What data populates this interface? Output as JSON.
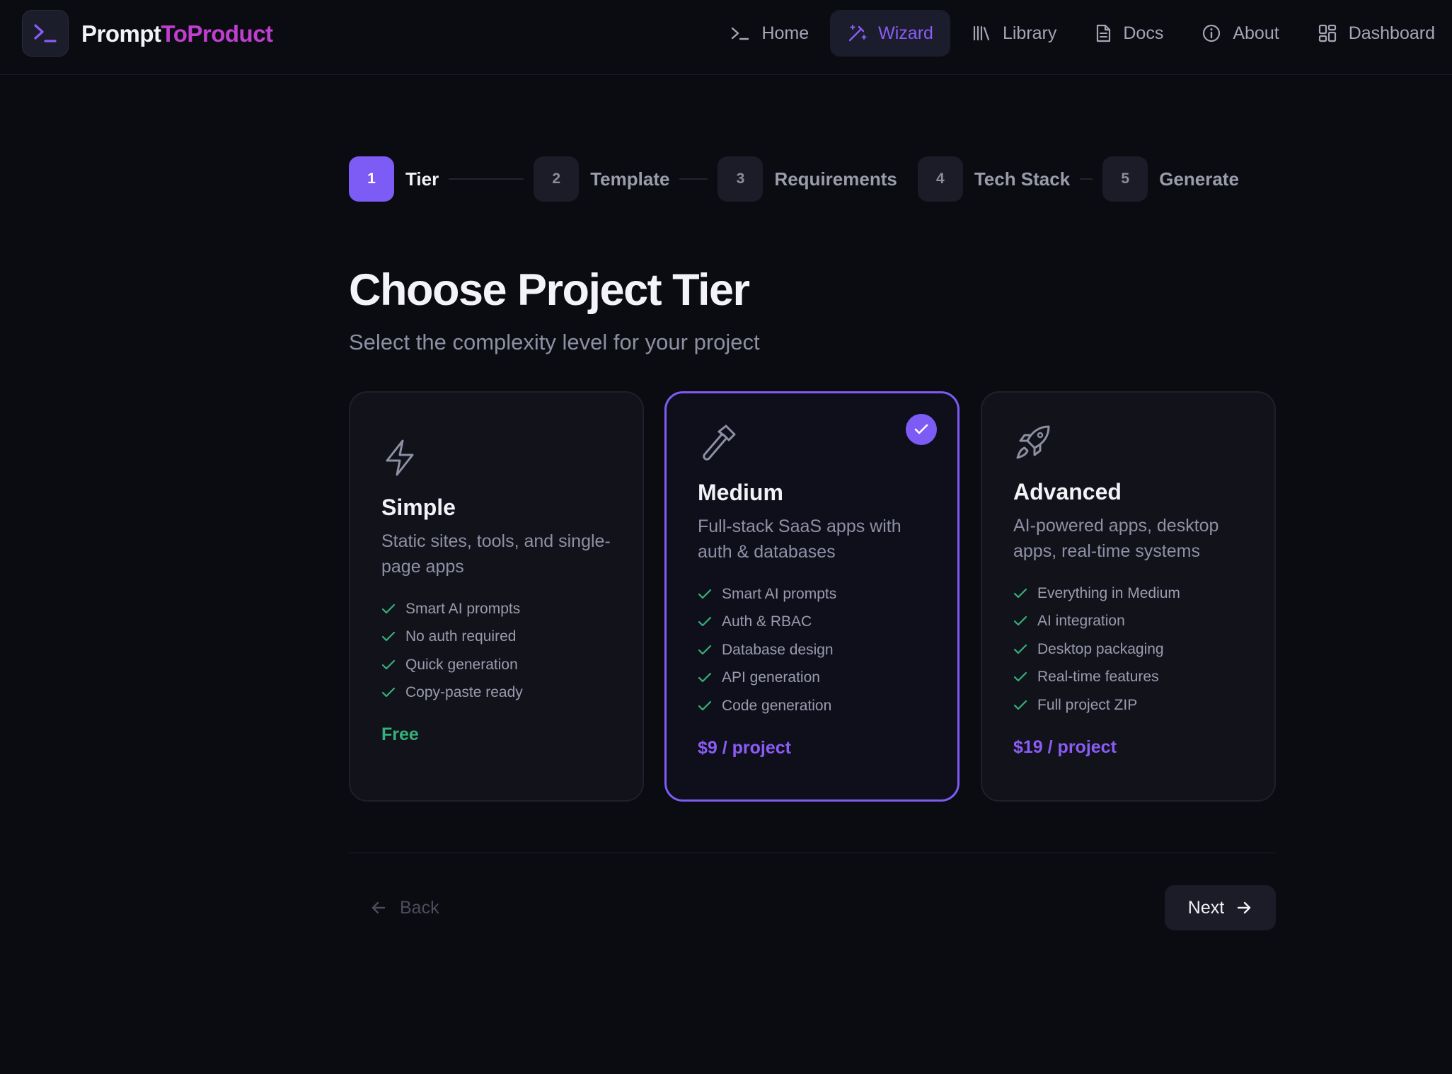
{
  "header": {
    "brand_part1": "Prompt",
    "brand_part2": "ToProduct",
    "logo_icon": "terminal-icon",
    "nav": [
      {
        "label": "Home",
        "icon": "terminal-icon"
      },
      {
        "label": "Wizard",
        "icon": "magic-wand-icon",
        "active": true
      },
      {
        "label": "Library",
        "icon": "library-icon"
      },
      {
        "label": "Docs",
        "icon": "document-icon"
      },
      {
        "label": "About",
        "icon": "info-icon"
      },
      {
        "label": "Dashboard",
        "icon": "grid-icon"
      }
    ]
  },
  "stepper": [
    {
      "num": "1",
      "label": "Tier",
      "active": true
    },
    {
      "num": "2",
      "label": "Template"
    },
    {
      "num": "3",
      "label": "Requirements"
    },
    {
      "num": "4",
      "label": "Tech Stack"
    },
    {
      "num": "5",
      "label": "Generate"
    }
  ],
  "page": {
    "title": "Choose Project Tier",
    "subtitle": "Select the complexity level for your project"
  },
  "tiers": [
    {
      "title": "Simple",
      "icon": "lightning-icon",
      "description": "Static sites, tools, and single-page apps",
      "features": [
        "Smart AI prompts",
        "No auth required",
        "Quick generation",
        "Copy-paste ready"
      ],
      "price": "Free"
    },
    {
      "title": "Medium",
      "icon": "hammer-icon",
      "selected": true,
      "description": "Full-stack SaaS apps with auth & databases",
      "features": [
        "Smart AI prompts",
        "Auth & RBAC",
        "Database design",
        "API generation",
        "Code generation"
      ],
      "price": "$9 / project"
    },
    {
      "title": "Advanced",
      "icon": "rocket-icon",
      "description": "AI-powered apps, desktop apps, real-time systems",
      "features": [
        "Everything in Medium",
        "AI integration",
        "Desktop packaging",
        "Real-time features",
        "Full project ZIP"
      ],
      "price": "$19 / project"
    }
  ],
  "footer": {
    "back_label": "Back",
    "next_label": "Next"
  },
  "colors": {
    "accent": "#7c5cf5",
    "brand_accent": "#c13fd0",
    "free": "#34b27b",
    "check": "#34b27b",
    "background": "#0b0c11"
  }
}
